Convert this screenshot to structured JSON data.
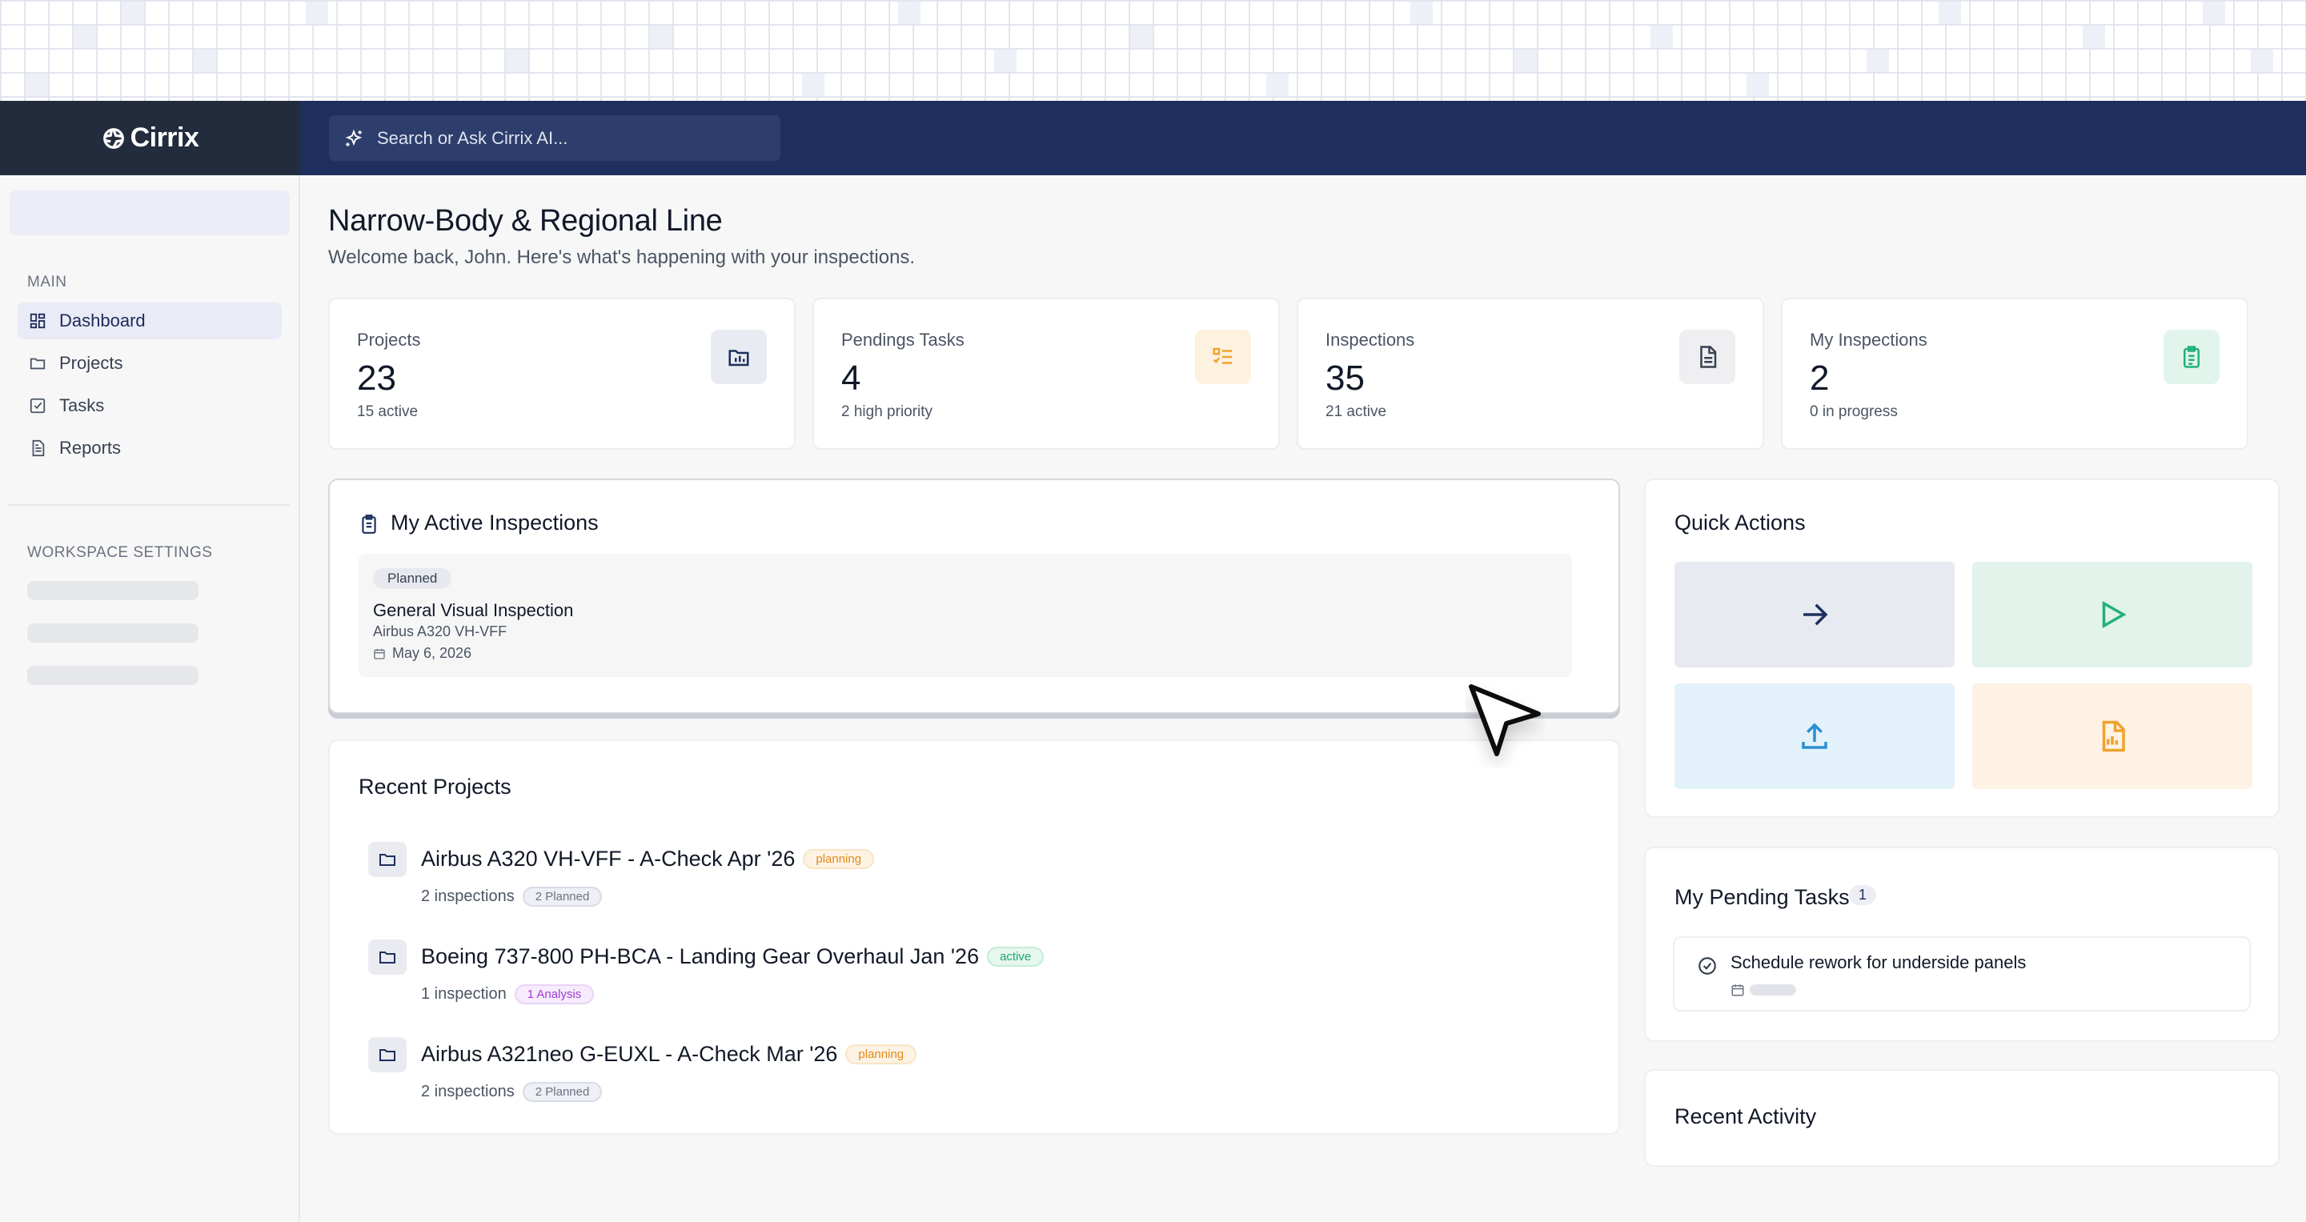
{
  "brand": {
    "name": "Cirrix"
  },
  "search": {
    "placeholder": "Search or Ask Cirrix AI..."
  },
  "sidebar": {
    "main_section": "MAIN",
    "items": [
      {
        "label": "Dashboard",
        "icon": "dashboard-icon",
        "active": true
      },
      {
        "label": "Projects",
        "icon": "folder-icon",
        "active": false
      },
      {
        "label": "Tasks",
        "icon": "checkbox-icon",
        "active": false
      },
      {
        "label": "Reports",
        "icon": "document-icon",
        "active": false
      }
    ],
    "workspace_section": "WORKSPACE SETTINGS"
  },
  "page": {
    "title": "Narrow-Body & Regional Line",
    "subtitle": "Welcome back, John. Here's what's happening with your inspections."
  },
  "stats": [
    {
      "label": "Projects",
      "value": "23",
      "sub": "15 active",
      "icon": "chart-folder-icon",
      "color": "#e9ebf2"
    },
    {
      "label": "Pendings Tasks",
      "value": "4",
      "sub": "2 high priority",
      "icon": "task-list-icon",
      "color": "#fdf1e0"
    },
    {
      "label": "Inspections",
      "value": "35",
      "sub": "21 active",
      "icon": "document-icon",
      "color": "#efeff1"
    },
    {
      "label": "My Inspections",
      "value": "2",
      "sub": "0 in progress",
      "icon": "clipboard-icon",
      "color": "#e1f5ec"
    }
  ],
  "active_inspections": {
    "title": "My Active Inspections",
    "items": [
      {
        "status": "Planned",
        "title": "General Visual Inspection",
        "aircraft": "Airbus A320 VH-VFF",
        "date": "May 6, 2026"
      }
    ]
  },
  "recent_projects": {
    "title": "Recent Projects",
    "items": [
      {
        "title": "Airbus A320 VH-VFF - A-Check Apr '26",
        "status": "planning",
        "meta": "2 inspections",
        "tag": "2 Planned"
      },
      {
        "title": "Boeing 737-800 PH-BCA - Landing Gear Overhaul Jan '26",
        "status": "active",
        "meta": "1 inspection",
        "tag": "1 Analysis"
      },
      {
        "title": "Airbus A321neo G-EUXL - A-Check Mar '26",
        "status": "planning",
        "meta": "2 inspections",
        "tag": "2 Planned"
      }
    ]
  },
  "quick_actions": {
    "title": "Quick Actions",
    "tiles": [
      {
        "icon": "arrow-right-icon",
        "bg": "#e8eaf2",
        "fg": "#1e2f5e"
      },
      {
        "icon": "play-icon",
        "bg": "#e1f3ea",
        "fg": "#22b07d"
      },
      {
        "icon": "upload-icon",
        "bg": "#e3f1fb",
        "fg": "#2b8fd1"
      },
      {
        "icon": "report-chart-icon",
        "bg": "#fdf2e3",
        "fg": "#f0a22e"
      }
    ]
  },
  "pending_tasks": {
    "title": "My Pending Tasks",
    "count": "1",
    "items": [
      {
        "title": "Schedule rework for underside panels"
      }
    ]
  },
  "recent_activity": {
    "title": "Recent Activity"
  }
}
